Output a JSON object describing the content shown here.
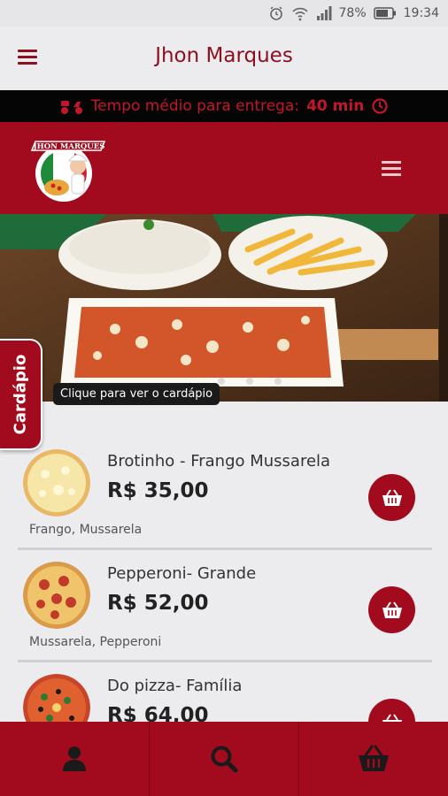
{
  "status": {
    "battery": "78%",
    "time": "19:34"
  },
  "header": {
    "title": "Jhon Marques"
  },
  "delivery": {
    "label": "Tempo médio para entrega:",
    "value": "40 min"
  },
  "brand": {
    "logo_text": "JHON MARQUES"
  },
  "hero": {
    "tooltip": "Clique para ver o cardápio",
    "side_tab": "Cardápio"
  },
  "products": [
    {
      "name": "Brotinho - Frango Mussarela",
      "price": "R$ 35,00",
      "description": "Frango, Mussarela"
    },
    {
      "name": "Pepperoni- Grande",
      "price": "R$ 52,00",
      "description": "Mussarela, Pepperoni"
    },
    {
      "name": "Do pizza- Família",
      "price": "R$ 64,00",
      "description": ""
    }
  ],
  "colors": {
    "brand_red": "#a20b1d",
    "accent_red": "#c3162b",
    "title_red": "#8d1020"
  },
  "bottom_nav": [
    "user-icon",
    "search-icon",
    "basket-icon"
  ]
}
